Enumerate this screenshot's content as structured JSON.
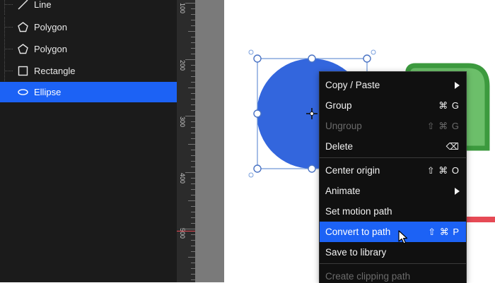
{
  "layers": [
    {
      "label": "Line",
      "icon": "line-icon",
      "selected": false
    },
    {
      "label": "Polygon",
      "icon": "polygon-icon",
      "selected": false
    },
    {
      "label": "Polygon",
      "icon": "polygon-icon",
      "selected": false
    },
    {
      "label": "Rectangle",
      "icon": "rectangle-icon",
      "selected": false
    },
    {
      "label": "Ellipse",
      "icon": "ellipse-icon",
      "selected": true
    }
  ],
  "ruler": {
    "labels": [
      "100",
      "200",
      "300",
      "400",
      "500"
    ]
  },
  "canvas": {
    "ellipse_color": "#3366dd",
    "rounded_rect_fill": "#6cbf6a",
    "rounded_rect_stroke": "#3c9a3e",
    "accent_line_color": "#e64a55"
  },
  "menu": {
    "items": [
      {
        "label": "Copy / Paste",
        "shortcut": "",
        "submenu": true,
        "disabled": false,
        "active": false
      },
      {
        "label": "Group",
        "shortcut": "⌘ G",
        "submenu": false,
        "disabled": false,
        "active": false
      },
      {
        "label": "Ungroup",
        "shortcut": "⇧ ⌘ G",
        "submenu": false,
        "disabled": true,
        "active": false
      },
      {
        "label": "Delete",
        "shortcut": "⌫",
        "submenu": false,
        "disabled": false,
        "active": false
      },
      {
        "label": "Center origin",
        "shortcut": "⇧ ⌘ O",
        "submenu": false,
        "disabled": false,
        "active": false
      },
      {
        "label": "Animate",
        "shortcut": "",
        "submenu": true,
        "disabled": false,
        "active": false
      },
      {
        "label": "Set motion path",
        "shortcut": "",
        "submenu": false,
        "disabled": false,
        "active": false
      },
      {
        "label": "Convert to path",
        "shortcut": "⇧ ⌘ P",
        "submenu": false,
        "disabled": false,
        "active": true
      },
      {
        "label": "Save to library",
        "shortcut": "",
        "submenu": false,
        "disabled": false,
        "active": false
      },
      {
        "label": "Create clipping path",
        "shortcut": "",
        "submenu": false,
        "disabled": true,
        "active": false
      }
    ]
  },
  "colors": {
    "accent": "#1c62f5",
    "panel": "#1b1b1b",
    "menu": "#101010"
  }
}
